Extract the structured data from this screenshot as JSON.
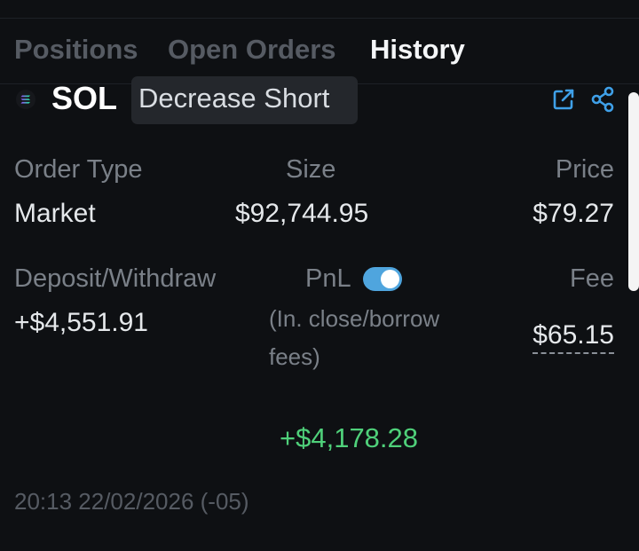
{
  "tabs": [
    {
      "label": "Positions",
      "active": false
    },
    {
      "label": "Open Orders",
      "active": false
    },
    {
      "label": "History",
      "active": true
    }
  ],
  "trade": {
    "token": "SOL",
    "action": "Decrease Short",
    "token_icon": "solana-logo-icon",
    "actions": [
      "external-link-icon",
      "share-icon"
    ]
  },
  "details": {
    "order_type_label": "Order Type",
    "order_type_value": "Market",
    "size_label": "Size",
    "size_value": "$92,744.95",
    "price_label": "Price",
    "price_value": "$79.27",
    "deposit_label": "Deposit/Withdraw",
    "deposit_value": "+$4,551.91",
    "pnl_label": "PnL",
    "pnl_toggle_on": true,
    "pnl_note": "(In. close/borrow fees)",
    "pnl_value": "+$4,178.28",
    "fee_label": "Fee",
    "fee_value": "$65.15",
    "timestamp": "20:13 22/02/2026 (-05)"
  },
  "colors": {
    "background": "#0e1013",
    "accent": "#4fa5de",
    "positive": "#4fd07a",
    "muted_text": "#7a8088"
  }
}
